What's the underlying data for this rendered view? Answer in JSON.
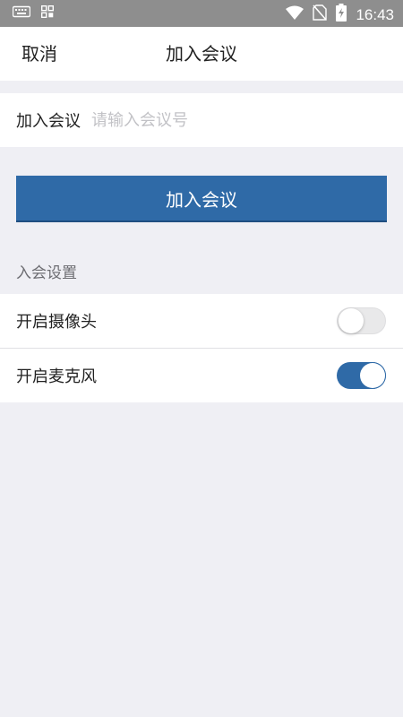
{
  "status_bar": {
    "time": "16:43",
    "left_icons": [
      "keyboard-icon",
      "apps-grid-icon"
    ],
    "right_icons": [
      "wifi-icon",
      "no-sim-icon",
      "battery-charging-icon"
    ],
    "background": "#8e8e8e"
  },
  "nav": {
    "cancel_label": "取消",
    "title": "加入会议"
  },
  "meeting_input": {
    "label": "加入会议",
    "placeholder": "请输入会议号",
    "value": ""
  },
  "join_button": {
    "label": "加入会议",
    "color": "#2f6aa7"
  },
  "settings": {
    "section_label": "入会设置",
    "items": [
      {
        "label": "开启摄像头",
        "enabled": false
      },
      {
        "label": "开启麦克风",
        "enabled": true
      }
    ]
  },
  "colors": {
    "accent": "#2f6aa7",
    "page_background": "#efeff4"
  }
}
